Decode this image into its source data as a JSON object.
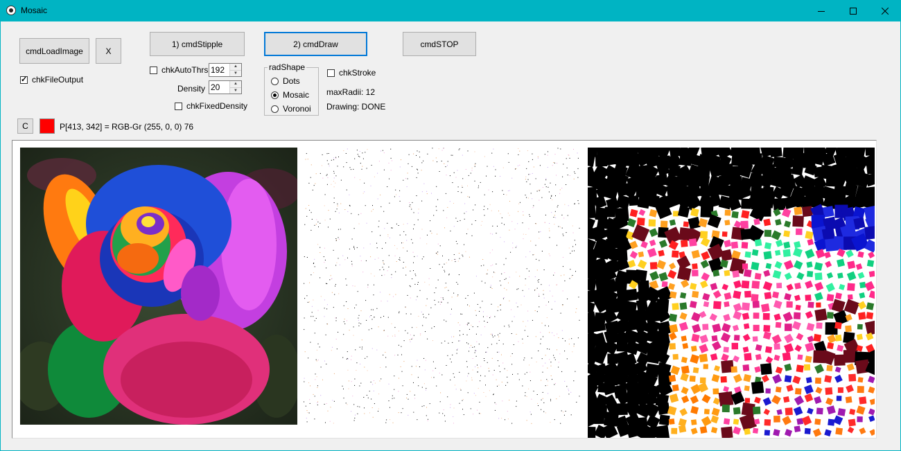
{
  "window": {
    "title": "Mosaic"
  },
  "buttons": {
    "load_image": "cmdLoadImage",
    "close_x": "X",
    "stipple": "1) cmdStipple",
    "draw": "2) cmdDraw",
    "stop": "cmdSTOP",
    "clear": "C"
  },
  "checkboxes": {
    "file_output": {
      "label": "chkFileOutput",
      "checked": true
    },
    "auto_thrs": {
      "label": "chkAutoThrs",
      "checked": false
    },
    "fixed_density": {
      "label": "chkFixedDensity",
      "checked": false
    },
    "stroke": {
      "label": "chkStroke",
      "checked": false
    }
  },
  "spinners": {
    "auto_thrs_value": "192",
    "density_label": "Density",
    "density_value": "20"
  },
  "rad_shape": {
    "title": "radShape",
    "options": [
      "Dots",
      "Mosaic",
      "Voronoi"
    ],
    "selected": "Mosaic"
  },
  "info": {
    "max_radii": "maxRadii: 12",
    "drawing_status": "Drawing: DONE",
    "pixel_readout": "P[413, 342] = RGB-Gr (255, 0, 0) 76"
  },
  "colors": {
    "titlebar": "#00b4c3",
    "picked_color": "#ff0000"
  },
  "icons": [
    "app-icon",
    "minimize-icon",
    "maximize-icon",
    "close-icon"
  ]
}
